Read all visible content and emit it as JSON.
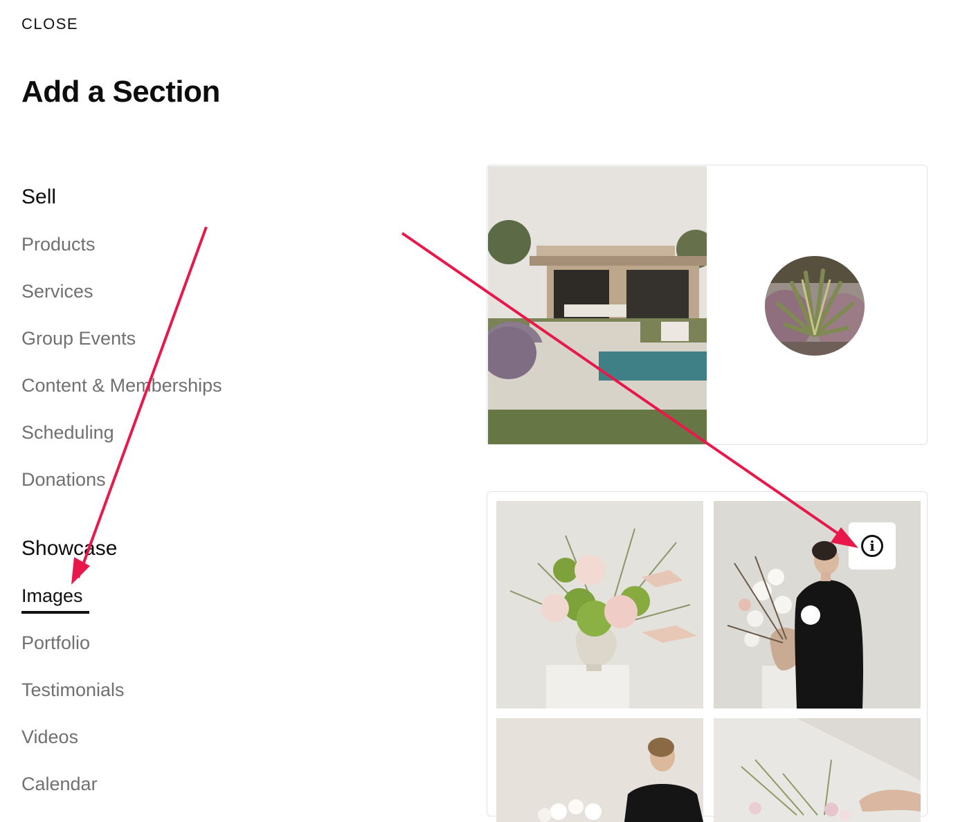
{
  "header": {
    "close_label": "CLOSE",
    "title": "Add a Section"
  },
  "sidebar": {
    "sell": {
      "heading": "Sell",
      "items": [
        {
          "label": "Products"
        },
        {
          "label": "Services"
        },
        {
          "label": "Group Events"
        },
        {
          "label": "Content & Memberships"
        },
        {
          "label": "Scheduling"
        },
        {
          "label": "Donations"
        }
      ]
    },
    "showcase": {
      "heading": "Showcase",
      "items": [
        {
          "label": "Images",
          "active": true
        },
        {
          "label": "Portfolio"
        },
        {
          "label": "Testimonials"
        },
        {
          "label": "Videos"
        },
        {
          "label": "Calendar"
        }
      ]
    }
  },
  "previews": {
    "layout_1": {
      "photo_1": "house-with-pool-photo",
      "photo_2": "agave-plant-circle-photo"
    },
    "layout_2": {
      "photos": [
        "flower-arrangement-vase-photo",
        "woman-arranging-orchids-photo",
        "woman-arranging-flowers-photo",
        "hands-arranging-flowers-photo"
      ],
      "info_icon": "info-icon"
    }
  },
  "annotations": {
    "arrow_color": "#e8194a"
  },
  "colors": {
    "text_primary": "#0d0d0d",
    "text_secondary": "#707070",
    "card_border": "#e2e2e2"
  }
}
